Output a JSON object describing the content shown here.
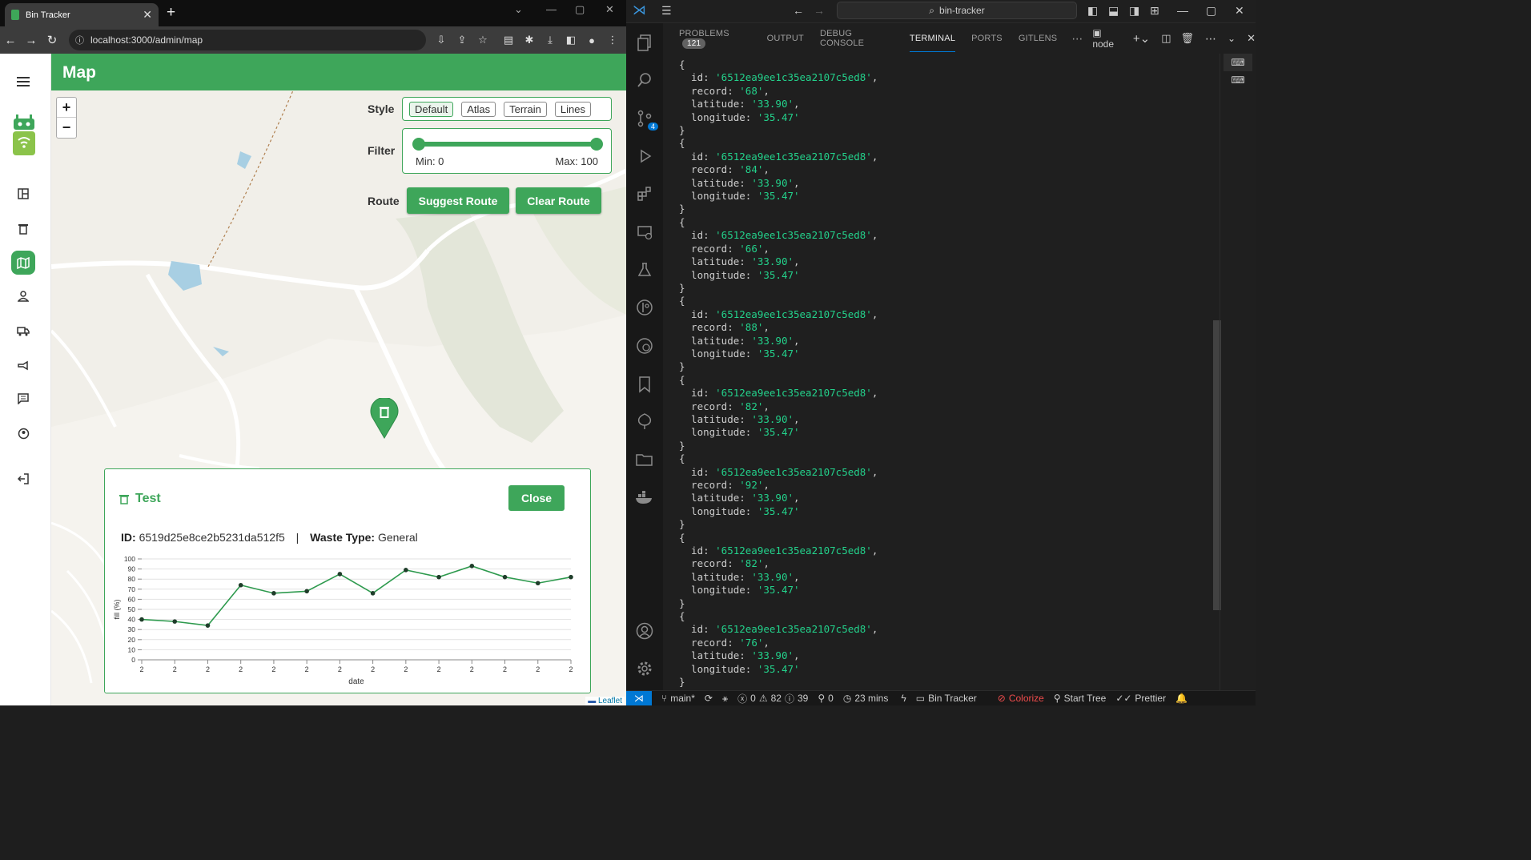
{
  "browser": {
    "tab_title": "Bin Tracker",
    "url": "localhost:3000/admin/map"
  },
  "app": {
    "page_title": "Map",
    "sidebar": [
      "menu",
      "dashboard",
      "bins",
      "map",
      "users",
      "trucks",
      "announcements",
      "messages",
      "profile",
      "logout"
    ]
  },
  "map_controls": {
    "style_label": "Style",
    "styles": [
      "Default",
      "Atlas",
      "Terrain",
      "Lines"
    ],
    "selected_style": "Default",
    "filter_label": "Filter",
    "filter_min_label": "Min: 0",
    "filter_max_label": "Max: 100",
    "filter_range": [
      0,
      100
    ],
    "route_label": "Route",
    "suggest_route": "Suggest Route",
    "clear_route": "Clear Route",
    "zoom_in": "+",
    "zoom_out": "−",
    "attribution": "Leaflet"
  },
  "popup": {
    "title": "Test",
    "close": "Close",
    "id_label": "ID:",
    "id_value": "6519d25e8ce2b5231da512f5",
    "separator": "|",
    "waste_label": "Waste Type:",
    "waste_value": "General"
  },
  "chart_data": {
    "type": "line",
    "xlabel": "date",
    "ylabel": "fill (%)",
    "ylim": [
      0,
      100
    ],
    "yticks": [
      0,
      10,
      20,
      30,
      40,
      50,
      60,
      70,
      80,
      90,
      100
    ],
    "categories": [
      "2",
      "2",
      "2",
      "2",
      "2",
      "2",
      "2",
      "2",
      "2",
      "2",
      "2",
      "2",
      "2",
      "2"
    ],
    "values": [
      40,
      38,
      34,
      74,
      66,
      68,
      85,
      66,
      89,
      82,
      93,
      82,
      76,
      82
    ],
    "color": "#2e9a4e"
  },
  "vscode": {
    "search": "bin-tracker",
    "panel_tabs": [
      "PROBLEMS",
      "OUTPUT",
      "DEBUG CONSOLE",
      "TERMINAL",
      "PORTS",
      "GITLENS"
    ],
    "active_tab": "TERMINAL",
    "problems_count": "121",
    "terminal_name": "node",
    "scm_badge": "4",
    "records": [
      {
        "id": "'6512ea9ee1c35ea2107c5ed8'",
        "record": "'68'",
        "latitude": "'33.90'",
        "longitude": "'35.47'"
      },
      {
        "id": "'6512ea9ee1c35ea2107c5ed8'",
        "record": "'84'",
        "latitude": "'33.90'",
        "longitude": "'35.47'"
      },
      {
        "id": "'6512ea9ee1c35ea2107c5ed8'",
        "record": "'66'",
        "latitude": "'33.90'",
        "longitude": "'35.47'"
      },
      {
        "id": "'6512ea9ee1c35ea2107c5ed8'",
        "record": "'88'",
        "latitude": "'33.90'",
        "longitude": "'35.47'"
      },
      {
        "id": "'6512ea9ee1c35ea2107c5ed8'",
        "record": "'82'",
        "latitude": "'33.90'",
        "longitude": "'35.47'"
      },
      {
        "id": "'6512ea9ee1c35ea2107c5ed8'",
        "record": "'92'",
        "latitude": "'33.90'",
        "longitude": "'35.47'"
      },
      {
        "id": "'6512ea9ee1c35ea2107c5ed8'",
        "record": "'82'",
        "latitude": "'33.90'",
        "longitude": "'35.47'"
      },
      {
        "id": "'6512ea9ee1c35ea2107c5ed8'",
        "record": "'76'",
        "latitude": "'33.90'",
        "longitude": "'35.47'"
      }
    ],
    "status": {
      "branch": "main*",
      "errors": "0",
      "warnings": "82",
      "info": "39",
      "ports": "0",
      "time": "23 mins",
      "project": "Bin Tracker",
      "colorize": "Colorize",
      "start_tree": "Start Tree",
      "prettier": "Prettier"
    }
  }
}
